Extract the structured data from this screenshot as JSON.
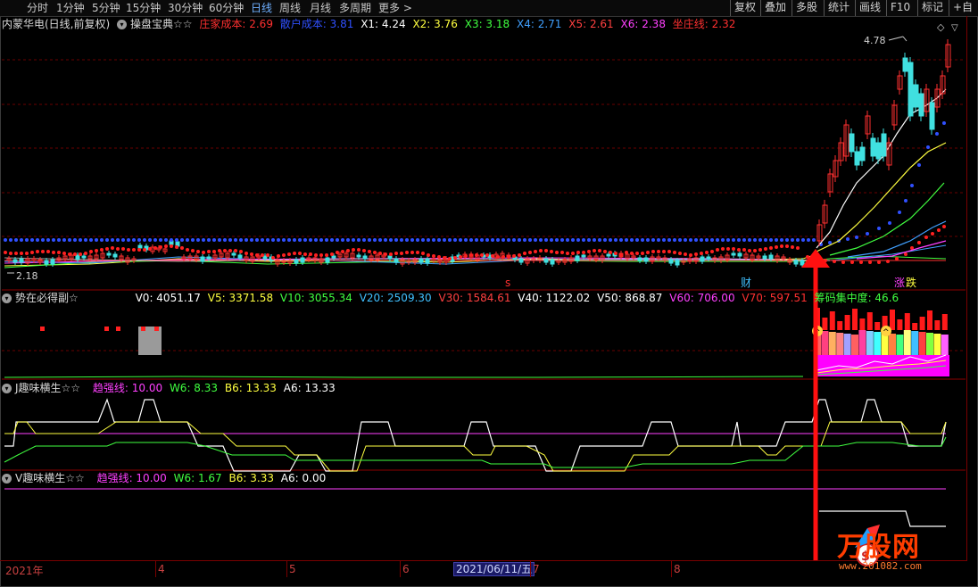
{
  "toolbar": {
    "periods": [
      "分时",
      "1分钟",
      "5分钟",
      "15分钟",
      "30分钟",
      "60分钟",
      "日线",
      "周线",
      "月线",
      "多周期",
      "更多 >"
    ],
    "active_period": "日线",
    "right_buttons": [
      "复权",
      "叠加",
      "多股",
      "统计",
      "画线",
      "F10",
      "标记",
      "+自"
    ]
  },
  "main_pane": {
    "stock_title": "内蒙华电(日线,前复权)",
    "indicator_name": "操盘宝典☆☆",
    "values": [
      {
        "label": "庄家成本: 2.69",
        "color": "#ff3030"
      },
      {
        "label": "散户成本: 3.81",
        "color": "#3050ff"
      },
      {
        "label": "X1: 4.24",
        "color": "#ffffff"
      },
      {
        "label": "X2: 3.76",
        "color": "#ffff40"
      },
      {
        "label": "X3: 3.18",
        "color": "#40ff40"
      },
      {
        "label": "X4: 2.71",
        "color": "#40a0ff"
      },
      {
        "label": "X5: 2.61",
        "color": "#ff4040"
      },
      {
        "label": "X6: 2.38",
        "color": "#ff40ff"
      },
      {
        "label": "坐庄线: 2.32",
        "color": "#ff3030"
      }
    ],
    "high_label": "4.78",
    "low_label": "2.18",
    "markers": {
      "s": "s",
      "cai": "财",
      "zhang": "涨",
      "die": "跌"
    }
  },
  "volume_pane": {
    "indicator_name": "势在必得副☆",
    "values": [
      {
        "label": "V0: 4051.17",
        "color": "#ffffff"
      },
      {
        "label": "V5: 3371.58",
        "color": "#ffff40"
      },
      {
        "label": "V10: 3055.34",
        "color": "#40ff40"
      },
      {
        "label": "V20: 2509.30",
        "color": "#40c0ff"
      },
      {
        "label": "V30: 1584.61",
        "color": "#ff4040"
      },
      {
        "label": "V40: 1122.02",
        "color": "#ffffff"
      },
      {
        "label": "V50: 868.87",
        "color": "#ffffff"
      },
      {
        "label": "V60: 706.00",
        "color": "#ff40ff"
      },
      {
        "label": "V70: 597.51",
        "color": "#ff3030"
      },
      {
        "label": "筹码集中度: 46.6",
        "color": "#40ff40"
      }
    ]
  },
  "j_pane": {
    "indicator_name": "J趣味横生☆☆",
    "values": [
      {
        "label": "趋强线: 10.00",
        "color": "#ff40ff"
      },
      {
        "label": "W6: 8.33",
        "color": "#40ff40"
      },
      {
        "label": "B6: 13.33",
        "color": "#ffff40"
      },
      {
        "label": "A6: 13.33",
        "color": "#ffffff"
      }
    ]
  },
  "v_pane": {
    "indicator_name": "V趣味横生☆☆",
    "values": [
      {
        "label": "趋强线: 10.00",
        "color": "#ff40ff"
      },
      {
        "label": "W6: 1.67",
        "color": "#40ff40"
      },
      {
        "label": "B6: 3.33",
        "color": "#ffff40"
      },
      {
        "label": "A6: 0.00",
        "color": "#ffffff"
      }
    ]
  },
  "date_axis": {
    "labels": [
      "2021年",
      "4",
      "5",
      "6",
      "7",
      "8"
    ],
    "cursor_date": "2021/06/11/五"
  },
  "watermark": {
    "brand": "万股网",
    "site": "www.201082.com"
  },
  "colors": {
    "up": "#ff3030",
    "down": "#40e0e0",
    "grid": "#8b0000",
    "accent": "#ff2020"
  }
}
